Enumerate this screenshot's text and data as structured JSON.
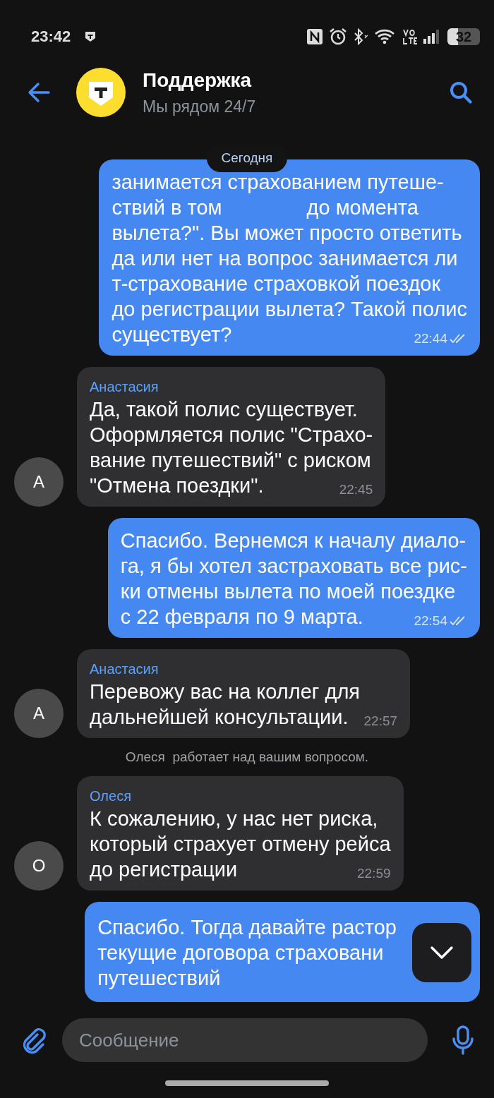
{
  "status_bar": {
    "time": "23:42",
    "battery": "32"
  },
  "header": {
    "title": "Поддержка",
    "subtitle": "Мы рядом 24/7"
  },
  "date_pill": "Сегодня",
  "messages": [
    {
      "kind": "outgoing",
      "lines": [
        [
          "занимается страхованием путеше-"
        ],
        [
          "ствий в том",
          "до момента"
        ],
        [
          "вылета?\". Вы может просто ответить"
        ],
        [
          "да или нет на вопрос занимается ли"
        ],
        [
          "т-страхование страховкой поездок"
        ],
        [
          "до регистрации вылета? Такой полис"
        ],
        [
          "существует?"
        ]
      ],
      "time": "22:44",
      "read": true
    },
    {
      "kind": "incoming",
      "author": "Анастасия",
      "avatar": "А",
      "lines": [
        [
          "Да, такой полис существует."
        ],
        [
          "Оформляется полис \"Страхо-"
        ],
        [
          "вание путешествий\" с риском"
        ],
        [
          "\"Отмена поездки\"."
        ]
      ],
      "time": "22:45"
    },
    {
      "kind": "outgoing",
      "lines": [
        [
          "Спасибо. Вернемся к началу диало-"
        ],
        [
          "га, я бы хотел застраховать все рис-"
        ],
        [
          "ки отмены вылета по моей поездке"
        ],
        [
          "с 22 февраля по 9 марта."
        ]
      ],
      "time": "22:54",
      "read": true
    },
    {
      "kind": "incoming",
      "author": "Анастасия",
      "avatar": "А",
      "lines": [
        [
          "Перевожу вас на коллег для"
        ],
        [
          "дальнейшей консультации."
        ]
      ],
      "time": "22:57"
    },
    {
      "kind": "service",
      "text": "Олеся  работает над вашим вопросом."
    },
    {
      "kind": "incoming",
      "author": "Олеся",
      "avatar": "О",
      "lines": [
        [
          "К сожалению, у нас нет риска,"
        ],
        [
          "который страхует отмену рейса"
        ],
        [
          "до регистрации"
        ]
      ],
      "time": "22:59"
    },
    {
      "kind": "outgoing",
      "lines": [
        [
          "Спасибо. Тогда давайте растор"
        ],
        [
          "текущие договора страховани"
        ],
        [
          "путешествий"
        ]
      ]
    }
  ],
  "composer": {
    "placeholder": "Сообщение"
  }
}
